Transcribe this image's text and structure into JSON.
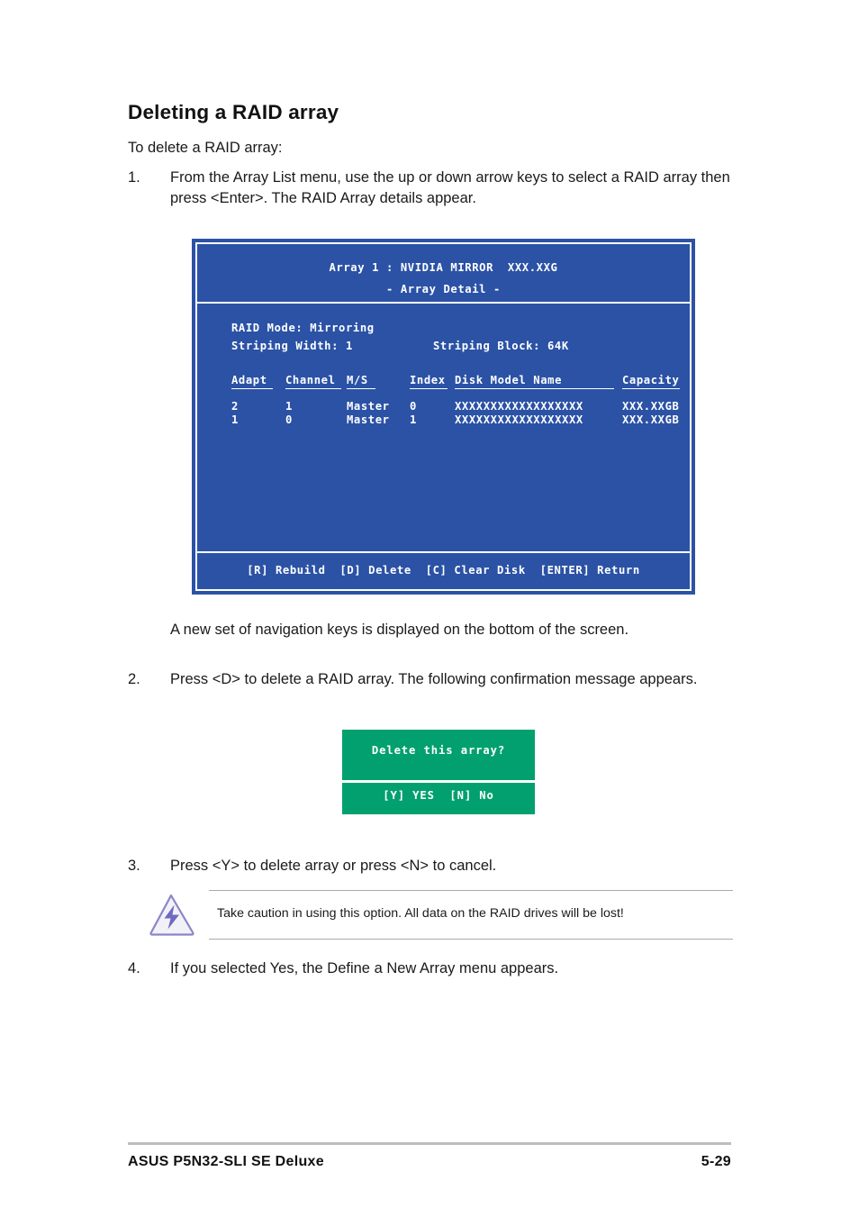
{
  "page": {
    "heading": "Deleting a RAID array",
    "lead": "To delete a RAID array:"
  },
  "steps": [
    {
      "num": "1.",
      "text": "From the Array List menu, use the up or down arrow keys to select a RAID array then press <Enter>. The RAID Array details appear."
    },
    {
      "num": "2.",
      "text": "Press <D> to delete a RAID array. The following confirmation message appears."
    },
    {
      "num": "3.",
      "text": "Press <Y> to delete array or press <N> to cancel."
    },
    {
      "num": "4.",
      "text": "If you selected Yes, the Define a New Array menu appears."
    }
  ],
  "paragraph_after_bios": "A new set of  navigation keys is displayed on the bottom of the screen.",
  "bios": {
    "title_line1": "Array 1 : NVIDIA MIRROR  XXX.XXG",
    "title_line2": "- Array Detail -",
    "raid_mode": "RAID Mode: Mirroring",
    "striping_width": "Striping Width: 1",
    "striping_block": "Striping Block: 64K",
    "columns": [
      "Adapt",
      "Channel",
      "M/S",
      "Index",
      "Disk Model Name",
      "Capacity"
    ],
    "rows": [
      {
        "adapt": "2",
        "channel": "1",
        "ms": "Master",
        "index": "0",
        "model": "XXXXXXXXXXXXXXXXXX",
        "capacity": "XXX.XXGB"
      },
      {
        "adapt": "1",
        "channel": "0",
        "ms": "Master",
        "index": "1",
        "model": "XXXXXXXXXXXXXXXXXX",
        "capacity": "XXX.XXGB"
      }
    ],
    "nav_keys": "[R] Rebuild  [D] Delete  [C] Clear Disk  [ENTER] Return",
    "background_color": "#2b52a5"
  },
  "confirm_dialog": {
    "message": "Delete this array?",
    "keys": "[Y] YES  [N] No",
    "background_color": "#02a06e"
  },
  "note": {
    "icon": "warning-lightning-icon",
    "text": "Take caution in using this option. All data on the RAID drives will be lost!",
    "icon_color": "#8a86c8"
  },
  "footer": {
    "product": "ASUS P5N32-SLI SE Deluxe",
    "page_number": "5-29"
  }
}
